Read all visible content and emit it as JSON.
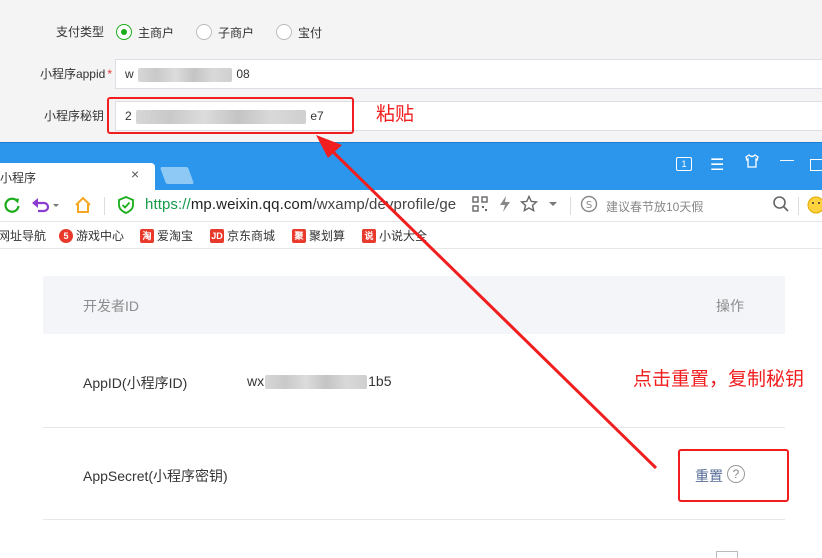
{
  "form": {
    "pay_type_label": "支付类型",
    "pay_types": [
      {
        "label": "主商户",
        "checked": true
      },
      {
        "label": "子商户",
        "checked": false
      },
      {
        "label": "宝付",
        "checked": false
      }
    ],
    "appid_label": "小程序appid",
    "appid_prefix": "w",
    "appid_suffix": "08",
    "secret_label": "小程序秘钥",
    "secret_prefix": "2",
    "secret_suffix": "e7",
    "paste_annotation": "粘贴"
  },
  "browser": {
    "tab_title": "小程序",
    "tab_close": "×",
    "url_scheme": "https://",
    "url_host": "mp.weixin.qq.com",
    "url_path": "/wxamp/devprofile/ge",
    "search_placeholder": "建议春节放10天假",
    "bookmarks": [
      {
        "label": "网址导航",
        "icon": "none",
        "color": ""
      },
      {
        "label": "游戏中心",
        "icon": "game-icon",
        "color": "#e8392b"
      },
      {
        "label": "爱淘宝",
        "icon": "taobao-icon",
        "color": "#e8392b"
      },
      {
        "label": "京东商城",
        "icon": "jd-icon",
        "color": "#e8392b"
      },
      {
        "label": "聚划算",
        "icon": "juhuasuan-icon",
        "color": "#e8392b"
      },
      {
        "label": "小说大全",
        "icon": "novel-icon",
        "color": "#e8392b"
      }
    ]
  },
  "table": {
    "col_id": "开发者ID",
    "col_ops": "操作",
    "rows": [
      {
        "name": "AppID(小程序ID)",
        "value_prefix": "wx",
        "value_suffix": "1b5"
      },
      {
        "name": "AppSecret(小程序密钥)",
        "action": "重置",
        "help": "?"
      }
    ]
  },
  "annotations": {
    "reset_copy": "点击重置，复制秘钥"
  },
  "colors": {
    "annotation_red": "#f01e1e",
    "browser_blue": "#2b96ec",
    "radio_green": "#1aad19",
    "link_blue": "#576b95"
  }
}
